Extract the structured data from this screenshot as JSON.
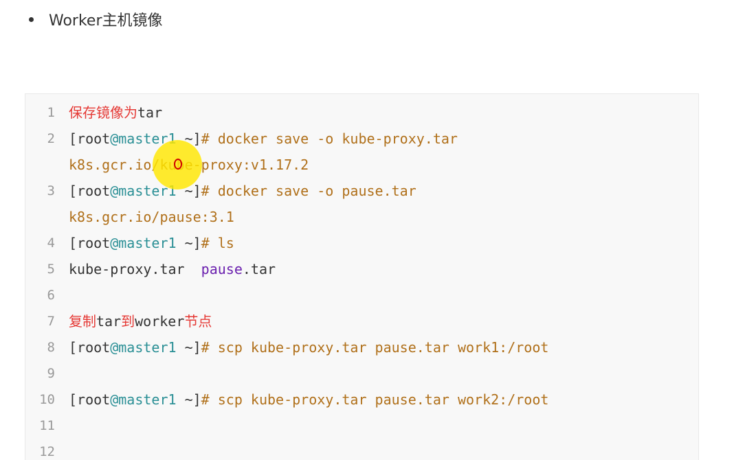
{
  "bullet": {
    "text": "Worker主机镜像"
  },
  "code": {
    "lines": [
      {
        "num": "1",
        "comment": "保存镜像为",
        "comment_tail": "tar"
      },
      {
        "num": "2",
        "prompt_open": "[root",
        "prompt_host": "@master1",
        "prompt_tilde": " ~]",
        "prompt_hash": "# ",
        "command": "docker save -o kube-proxy.tar",
        "continuation": "k8s.gcr.io/kube-proxy:v1.17.2"
      },
      {
        "num": "3",
        "prompt_open": "[root",
        "prompt_host": "@master1",
        "prompt_tilde": " ~]",
        "prompt_hash": "# ",
        "command": "docker save -o pause.tar",
        "continuation": "k8s.gcr.io/pause:3.1"
      },
      {
        "num": "4",
        "prompt_open": "[root",
        "prompt_host": "@master1",
        "prompt_tilde": " ~]",
        "prompt_hash": "# ",
        "command": "ls"
      },
      {
        "num": "5",
        "out_a": "kube-proxy.tar  ",
        "out_b": "pause",
        "out_c": ".tar"
      },
      {
        "num": "6"
      },
      {
        "num": "7",
        "part1": "复制",
        "part2": "tar",
        "part3": "到",
        "part4": "worker",
        "part5": "节点"
      },
      {
        "num": "8",
        "prompt_open": "[root",
        "prompt_host": "@master1",
        "prompt_tilde": " ~]",
        "prompt_hash": "# ",
        "command": "scp kube-proxy.tar pause.tar work1:/root"
      },
      {
        "num": "9"
      },
      {
        "num": "10",
        "prompt_open": "[root",
        "prompt_host": "@master1",
        "prompt_tilde": " ~]",
        "prompt_hash": "# ",
        "command": "scp kube-proxy.tar pause.tar work2:/root"
      },
      {
        "num": "11"
      },
      {
        "num": "12"
      }
    ]
  },
  "colors": {
    "comment": "#e53935",
    "host": "#2a8f95",
    "command": "#b0701a",
    "keyword": "#6a1fae",
    "text": "#333333",
    "line_number": "#999999",
    "highlight": "#ffe600"
  }
}
